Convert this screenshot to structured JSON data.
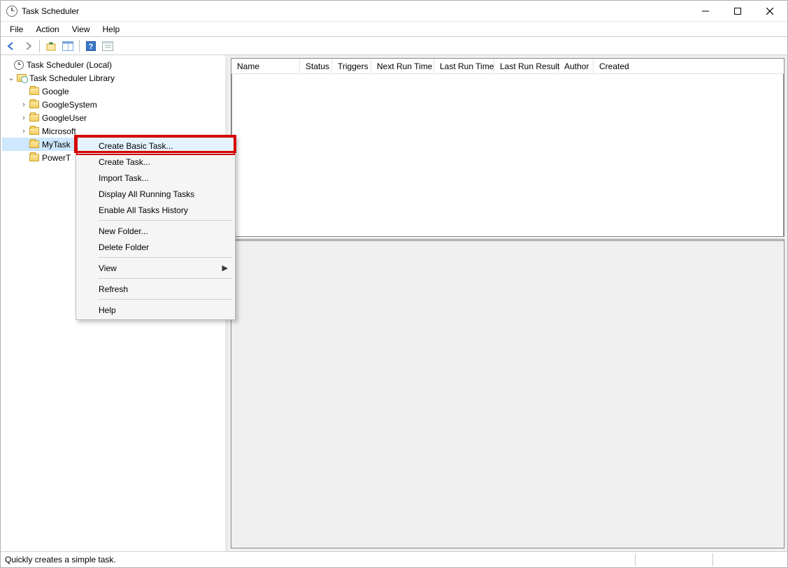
{
  "window": {
    "title": "Task Scheduler"
  },
  "menubar": [
    "File",
    "Action",
    "View",
    "Help"
  ],
  "tree": {
    "root": "Task Scheduler (Local)",
    "library": "Task Scheduler Library",
    "folders": [
      "Google",
      "GoogleSystem",
      "GoogleUser",
      "Microsoft",
      "MyTask",
      "PowerT"
    ]
  },
  "columns": [
    "Name",
    "Status",
    "Triggers",
    "Next Run Time",
    "Last Run Time",
    "Last Run Result",
    "Author",
    "Created"
  ],
  "context_menu": {
    "items": [
      "Create Basic Task...",
      "Create Task...",
      "Import Task...",
      "Display All Running Tasks",
      "Enable All Tasks History",
      "New Folder...",
      "Delete Folder",
      "View",
      "Refresh",
      "Help"
    ]
  },
  "statusbar": {
    "text": "Quickly creates a simple task."
  }
}
